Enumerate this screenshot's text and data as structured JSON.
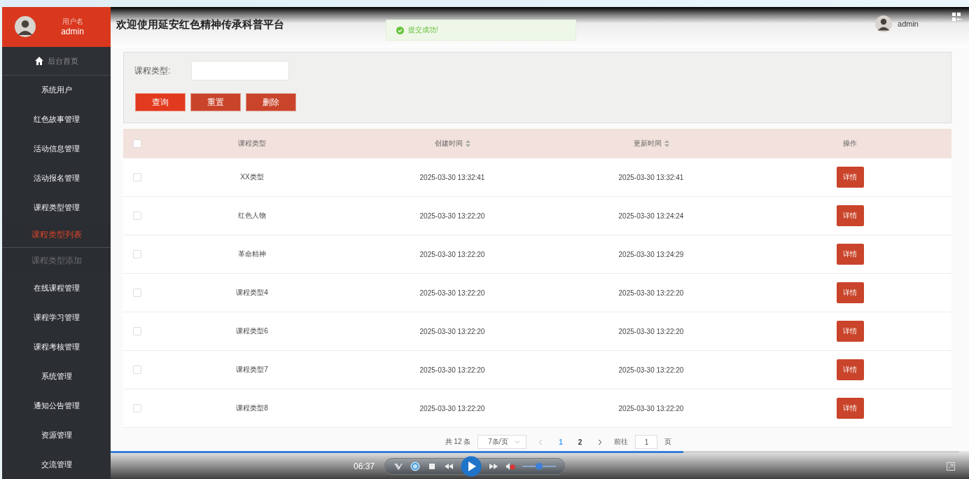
{
  "header": {
    "title": "欢迎使用延安红色精神传承科普平台",
    "user": "admin"
  },
  "toast": {
    "message": "提交成功!"
  },
  "sidebar": {
    "user_label": "用户名",
    "user_name": "admin",
    "home": "后台首页",
    "items": [
      {
        "label": "系统用户"
      },
      {
        "label": "红色故事管理"
      },
      {
        "label": "活动信息管理"
      },
      {
        "label": "活动报名管理"
      },
      {
        "label": "课程类型管理",
        "children": [
          {
            "label": "课程类型列表",
            "selected": true
          },
          {
            "label": "课程类型添加",
            "selected": false
          }
        ]
      },
      {
        "label": "在线课程管理"
      },
      {
        "label": "课程学习管理"
      },
      {
        "label": "课程考核管理"
      },
      {
        "label": "系统管理"
      },
      {
        "label": "通知公告管理"
      },
      {
        "label": "资源管理"
      },
      {
        "label": "交流管理"
      }
    ]
  },
  "search": {
    "label": "课程类型:",
    "buttons": [
      {
        "label": "查询",
        "kind": "primary"
      },
      {
        "label": "重置",
        "kind": "default"
      },
      {
        "label": "删除",
        "kind": "default"
      }
    ]
  },
  "table": {
    "header_checked": false,
    "columns": [
      {
        "label": "课程类型",
        "sortable": false
      },
      {
        "label": "创建时间",
        "sortable": true
      },
      {
        "label": "更新时间",
        "sortable": true
      },
      {
        "label": "操作",
        "sortable": false
      }
    ],
    "rows": [
      {
        "checked": false,
        "type": "XX类型",
        "created": "2025-03-30 13:32:41",
        "updated": "2025-03-30 13:32:41",
        "action": "详情"
      },
      {
        "checked": false,
        "type": "红色人物",
        "created": "2025-03-30 13:22:20",
        "updated": "2025-03-30 13:24:24",
        "action": "详情"
      },
      {
        "checked": false,
        "type": "革命精神",
        "created": "2025-03-30 13:22:20",
        "updated": "2025-03-30 13:24:29",
        "action": "详情"
      },
      {
        "checked": false,
        "type": "课程类型4",
        "created": "2025-03-30 13:22:20",
        "updated": "2025-03-30 13:22:20",
        "action": "详情"
      },
      {
        "checked": false,
        "type": "课程类型6",
        "created": "2025-03-30 13:22:20",
        "updated": "2025-03-30 13:22:20",
        "action": "详情"
      },
      {
        "checked": false,
        "type": "课程类型7",
        "created": "2025-03-30 13:22:20",
        "updated": "2025-03-30 13:22:20",
        "action": "详情"
      },
      {
        "checked": false,
        "type": "课程类型8",
        "created": "2025-03-30 13:22:20",
        "updated": "2025-03-30 13:22:20",
        "action": "详情"
      }
    ]
  },
  "pagination": {
    "total": "共 12 条",
    "page_size": "7条/页",
    "pages": [
      {
        "label": "1",
        "selected": true
      },
      {
        "label": "2",
        "selected": false
      }
    ],
    "goto_label": "前往",
    "goto_value": "1",
    "goto_suffix": "页"
  },
  "player": {
    "time": "06:37",
    "progress": {
      "level": 0.675
    },
    "volume": {
      "level": 0.5
    }
  }
}
